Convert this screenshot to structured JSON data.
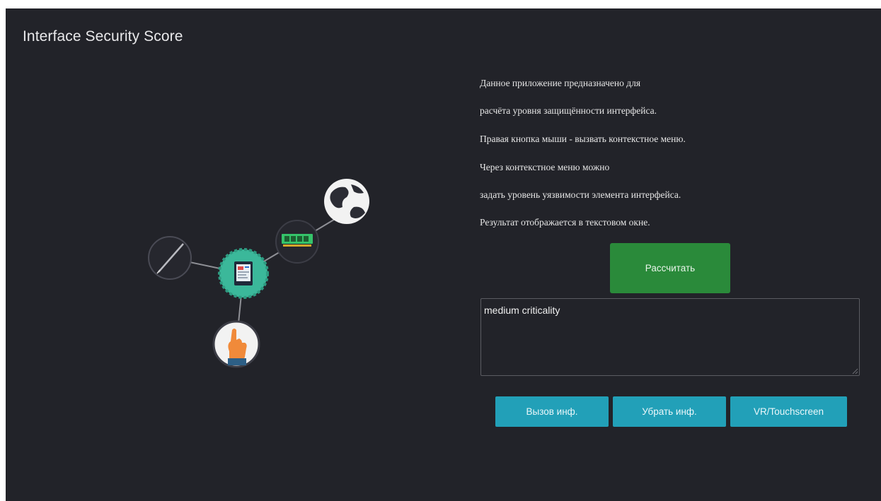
{
  "app": {
    "title": "Interface Security Score",
    "background_color": "#222329"
  },
  "diagram": {
    "nodes": [
      {
        "name": "stylus",
        "icon": "stylus-icon"
      },
      {
        "name": "tablet",
        "icon": "tablet-icon",
        "color": "#3bb89a"
      },
      {
        "name": "memory",
        "icon": "memory-chip-icon",
        "color": "#35c46a"
      },
      {
        "name": "globe",
        "icon": "globe-icon"
      },
      {
        "name": "hand",
        "icon": "hand-touch-icon",
        "color": "#f08a3a"
      }
    ]
  },
  "info": {
    "lines": [
      "Данное приложение предназначено для",
      "расчёта уровня защищённости интерфейса.",
      "Правая кнопка мыши - вызвать контекстное меню.",
      "Через контекстное меню можно",
      "задать уровень уязвимости элемента интерфейса.",
      "Результат отображается в текстовом окне."
    ]
  },
  "calculate": {
    "label": "Рассчитать",
    "color": "#2a8a3a"
  },
  "result": {
    "value": "medium criticality"
  },
  "buttons": {
    "show_info": "Вызов инф.",
    "hide_info": "Убрать инф.",
    "mode": "VR/Touchscreen",
    "color": "#22a0b8"
  }
}
